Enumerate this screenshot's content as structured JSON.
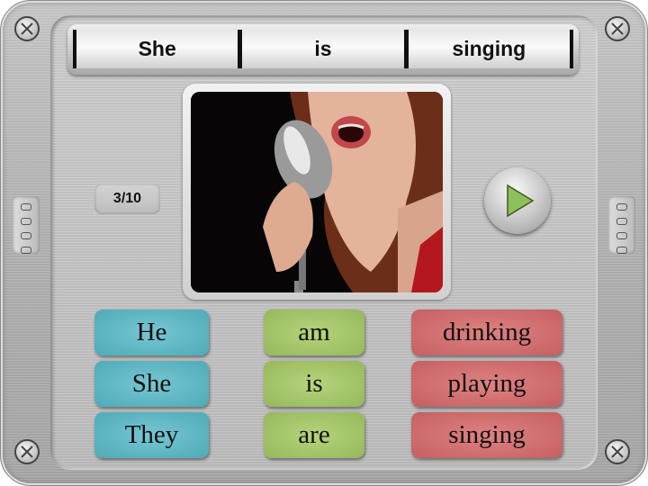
{
  "sentence": {
    "words": [
      "She",
      "is",
      "singing"
    ]
  },
  "counter": "3/10",
  "image": {
    "subject": "woman singing into a vintage microphone"
  },
  "play_button": {
    "icon": "play-triangle-icon",
    "color": "#8fbf5a"
  },
  "word_bank": {
    "subjects": {
      "color": "#5fb6c3",
      "items": [
        "He",
        "She",
        "They"
      ]
    },
    "verbs_be": {
      "color": "#a6c66b",
      "items": [
        "am",
        "is",
        "are"
      ]
    },
    "verbs_ing": {
      "color": "#d16e70",
      "items": [
        "drinking",
        "playing",
        "singing"
      ]
    }
  }
}
